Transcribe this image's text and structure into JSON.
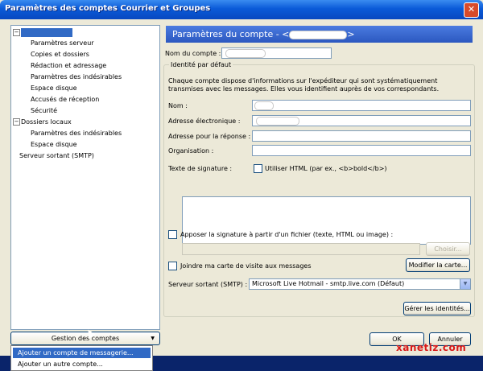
{
  "window": {
    "title": "Paramètres des comptes Courrier et Groupes",
    "close": "✕"
  },
  "tree": {
    "items": [
      "Paramètres serveur",
      "Copies et dossiers",
      "Rédaction et adressage",
      "Paramètres des indésirables",
      "Espace disque",
      "Accusés de réception",
      "Sécurité"
    ],
    "local_folders": "Dossiers locaux",
    "local_items": [
      "Paramètres des indésirables",
      "Espace disque"
    ],
    "smtp": "Serveur sortant (SMTP)",
    "expander_minus": "−"
  },
  "account_menu": {
    "button": "Gestion des comptes",
    "items": [
      "Ajouter un compte de messagerie...",
      "Ajouter un autre compte..."
    ]
  },
  "main": {
    "header_prefix": "Paramètres du compte - <",
    "header_suffix": ">",
    "account_name_label": "Nom du compte :",
    "identity_title": "Identité par défaut",
    "identity_desc": "Chaque compte dispose d'informations sur l'expéditeur qui sont systématiquement transmises avec les messages. Elles vous identifient auprès de vos correspondants.",
    "name_label": "Nom :",
    "email_label": "Adresse électronique :",
    "reply_label": "Adresse pour la réponse :",
    "org_label": "Organisation :",
    "sig_label": "Texte de signature :",
    "html_label": "Utiliser HTML (par ex., <b>bold</b>)",
    "attach_sig_label": "Apposer la signature à partir d'un fichier (texte, HTML ou image) :",
    "choose_button": "Choisir...",
    "vcard_label": "Joindre ma carte de visite aux messages",
    "edit_card_button": "Modifier la carte...",
    "smtp_label": "Serveur sortant (SMTP) :",
    "smtp_value": "Microsoft Live Hotmail - smtp.live.com (Défaut)",
    "identities_button": "Gérer les identités..."
  },
  "footer": {
    "ok": "OK",
    "cancel": "Annuler"
  },
  "watermark": "xanetiz.com"
}
